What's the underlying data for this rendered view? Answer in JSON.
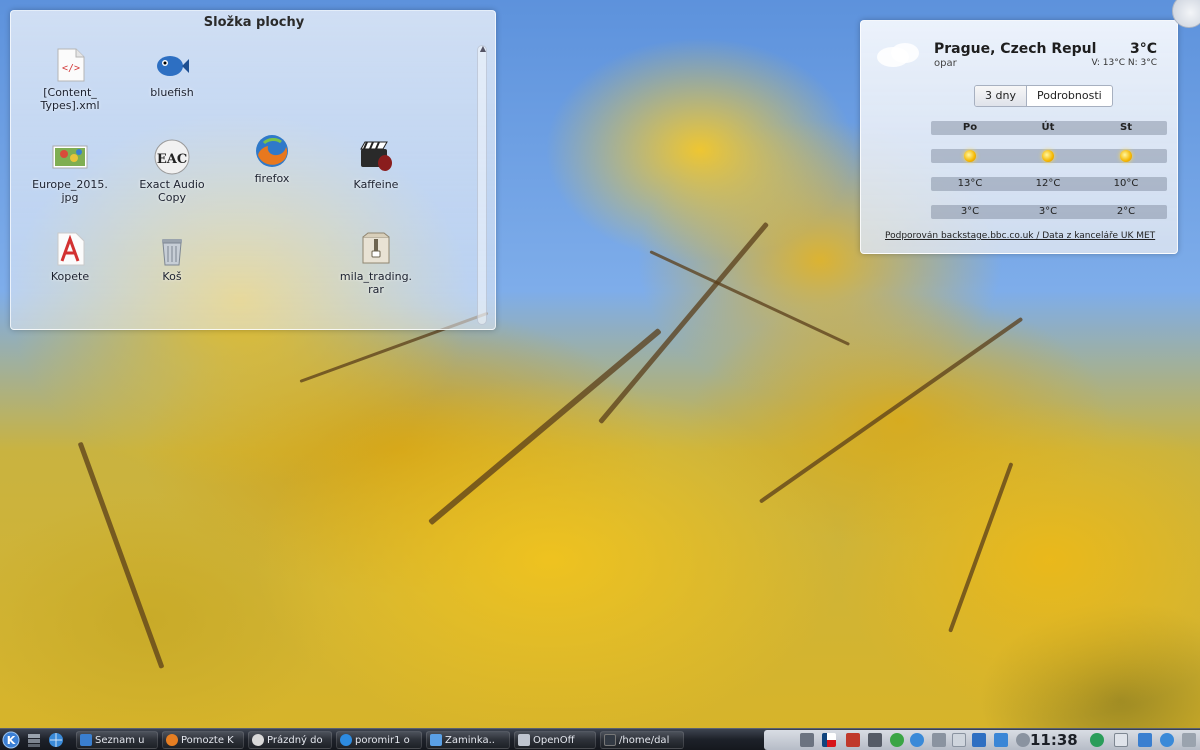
{
  "folderview": {
    "title": "Složka plochy",
    "icons": [
      {
        "label": "[Content_\nTypes].xml",
        "icon": "xml-file-icon"
      },
      {
        "label": "bluefish",
        "icon": "bluefish-icon"
      },
      {
        "label": "Europe_2015.\njpg",
        "icon": "image-file-icon"
      },
      {
        "label": "Exact Audio\nCopy",
        "icon": "eac-icon"
      },
      {
        "label": "firefox",
        "icon": "firefox-icon"
      },
      {
        "label": "Kaffeine",
        "icon": "kaffeine-icon"
      },
      {
        "label": "Kopete",
        "icon": "kopete-icon"
      },
      {
        "label": "Koš",
        "icon": "trash-icon"
      },
      {
        "label": "mila_trading.\nrar",
        "icon": "archive-file-icon"
      }
    ],
    "scroll_up": "▲"
  },
  "weather": {
    "city": "Prague, Czech Repul",
    "temperature": "3°C",
    "condition": "opar",
    "minmax": "V: 13°C N: 3°C",
    "tabs": [
      "3 dny",
      "Podrobnosti"
    ],
    "days": [
      "Po",
      "Út",
      "St"
    ],
    "highs": [
      "13°C",
      "12°C",
      "10°C"
    ],
    "lows": [
      "3°C",
      "3°C",
      "2°C"
    ],
    "credit": "Podporován backstage.bbc.co.uk / Data z kanceláře UK MET"
  },
  "taskbar": {
    "tasks": [
      {
        "label": "Seznam u",
        "color": "#3a7fd0"
      },
      {
        "label": "Pomozte K",
        "color": "#e67e22"
      },
      {
        "label": "Prázdný do",
        "color": "#d9d9d9"
      },
      {
        "label": "poromir1 o",
        "color": "#2d8be0"
      },
      {
        "label": "Zaminka..",
        "color": "#5aa0e6"
      },
      {
        "label": "OpenOff",
        "color": "#bfc5cf"
      },
      {
        "label": "/home/dal",
        "color": "#333a44"
      }
    ],
    "clock": "11:38"
  },
  "colors": {
    "taskbar_bg": "#1d2129",
    "tray_bg": "#c8cdd6",
    "sky": "#7aa8e8",
    "foliage": "#e6b820"
  }
}
